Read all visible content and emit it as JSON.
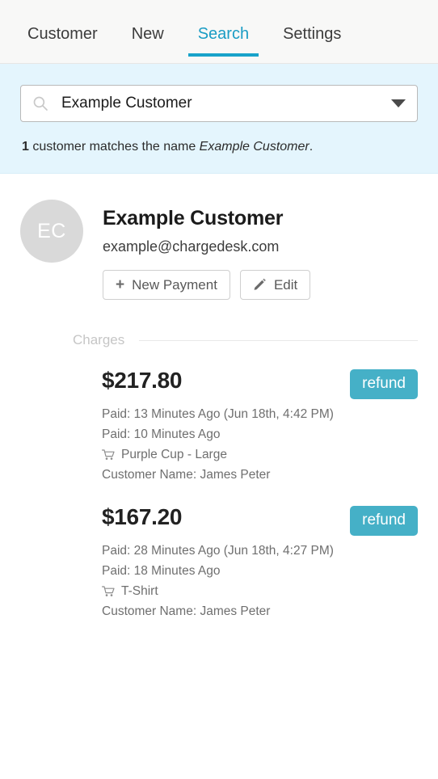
{
  "nav": {
    "tabs": [
      {
        "label": "Customer",
        "active": false
      },
      {
        "label": "New",
        "active": false
      },
      {
        "label": "Search",
        "active": true
      },
      {
        "label": "Settings",
        "active": false
      }
    ],
    "active_color": "#18a3ca",
    "inactive_color": "#3c3c3c"
  },
  "search": {
    "icon": "search-icon",
    "value": "Example Customer",
    "placeholder": "Search customers",
    "dropdown_icon": "chevron-down-icon",
    "panel_color": "#e4f5fd",
    "result_count": "1",
    "result_text_before": " customer matches the name ",
    "result_query": "Example Customer",
    "result_text_after": "."
  },
  "customer": {
    "avatar_initials": "EC",
    "avatar_color": "#d9d9d9",
    "name": "Example Customer",
    "email": "example@chargedesk.com",
    "actions": [
      {
        "label": "New Payment",
        "icon": "plus-icon"
      },
      {
        "label": "Edit",
        "icon": "pencil-icon"
      }
    ]
  },
  "charges_section": {
    "label": "Charges",
    "refund_color": "#45b0c7",
    "items": [
      {
        "amount": "$217.80",
        "refund_label": "refund",
        "paid_relative_full": "Paid: 13 Minutes Ago (Jun 18th, 4:42 PM)",
        "paid_relative": "Paid: 10 Minutes Ago",
        "product": "Purple Cup - Large",
        "product_icon": "cart-icon",
        "customer_name": "Customer Name: James Peter"
      },
      {
        "amount": "$167.20",
        "refund_label": "refund",
        "paid_relative_full": "Paid: 28 Minutes Ago (Jun 18th, 4:27 PM)",
        "paid_relative": "Paid: 18 Minutes Ago",
        "product": "T-Shirt",
        "product_icon": "cart-icon",
        "customer_name": "Customer Name: James Peter"
      }
    ]
  }
}
